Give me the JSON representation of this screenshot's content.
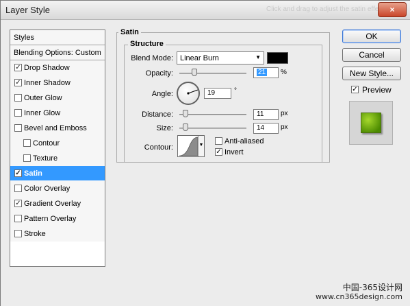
{
  "window": {
    "title": "Layer Style",
    "ghost_text": "Click and drag to adjust the satin effect",
    "close_glyph": "×"
  },
  "styles_panel": {
    "header": "Styles",
    "blending_label": "Blending Options: Custom",
    "items": [
      {
        "label": "Drop Shadow",
        "checked": true,
        "indent": false,
        "selected": false
      },
      {
        "label": "Inner Shadow",
        "checked": true,
        "indent": false,
        "selected": false
      },
      {
        "label": "Outer Glow",
        "checked": false,
        "indent": false,
        "selected": false
      },
      {
        "label": "Inner Glow",
        "checked": false,
        "indent": false,
        "selected": false
      },
      {
        "label": "Bevel and Emboss",
        "checked": false,
        "indent": false,
        "selected": false
      },
      {
        "label": "Contour",
        "checked": false,
        "indent": true,
        "selected": false
      },
      {
        "label": "Texture",
        "checked": false,
        "indent": true,
        "selected": false
      },
      {
        "label": "Satin",
        "checked": true,
        "indent": false,
        "selected": true
      },
      {
        "label": "Color Overlay",
        "checked": false,
        "indent": false,
        "selected": false
      },
      {
        "label": "Gradient Overlay",
        "checked": true,
        "indent": false,
        "selected": false
      },
      {
        "label": "Pattern Overlay",
        "checked": false,
        "indent": false,
        "selected": false
      },
      {
        "label": "Stroke",
        "checked": false,
        "indent": false,
        "selected": false
      }
    ]
  },
  "satin": {
    "group_title": "Satin",
    "structure_title": "Structure",
    "blend_mode_label": "Blend Mode:",
    "blend_mode_value": "Linear Burn",
    "blend_color": "#000000",
    "opacity_label": "Opacity:",
    "opacity_value": "21",
    "opacity_unit": "%",
    "angle_label": "Angle:",
    "angle_value": "19",
    "angle_unit": "°",
    "distance_label": "Distance:",
    "distance_value": "11",
    "distance_unit": "px",
    "size_label": "Size:",
    "size_value": "14",
    "size_unit": "px",
    "contour_label": "Contour:",
    "anti_aliased_label": "Anti-aliased",
    "anti_aliased_checked": false,
    "invert_label": "Invert",
    "invert_checked": true,
    "dropdown_glyph": "▼"
  },
  "buttons": {
    "ok": "OK",
    "cancel": "Cancel",
    "new_style": "New Style...",
    "preview_label": "Preview",
    "preview_checked": true,
    "preview_color": "#7fb517"
  },
  "watermark": {
    "line1": "中国-365设计网",
    "line2": "www.cn365design.com"
  }
}
